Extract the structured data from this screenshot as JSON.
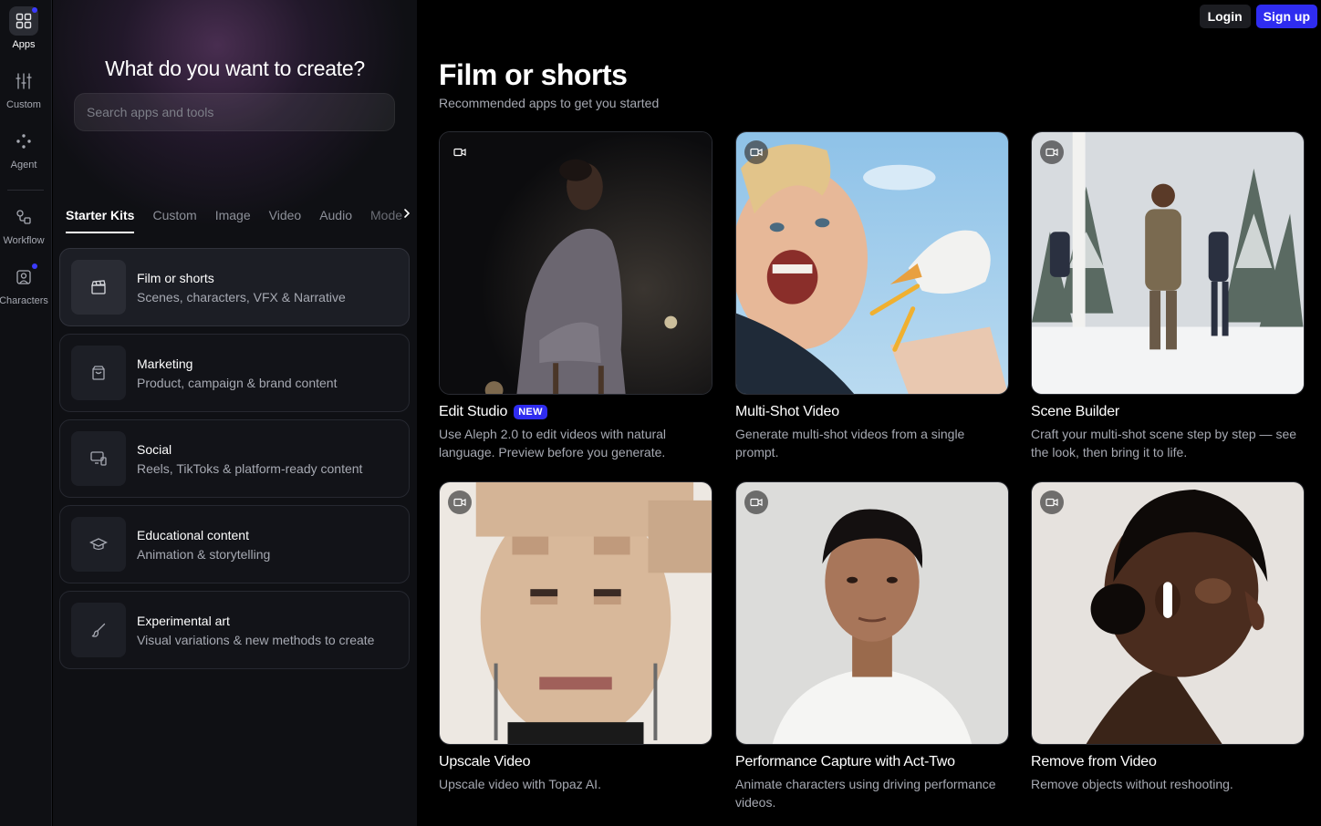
{
  "rail": {
    "items": [
      {
        "label": "Apps",
        "icon": "grid-icon",
        "active": true,
        "dot": true
      },
      {
        "label": "Custom",
        "icon": "sliders-icon",
        "active": false,
        "dot": false
      },
      {
        "label": "Agent",
        "icon": "sparkle-dots-icon",
        "active": false,
        "dot": false
      },
      {
        "label": "Workflow",
        "icon": "workflow-icon",
        "active": false,
        "dot": false
      },
      {
        "label": "Characters",
        "icon": "character-icon",
        "active": false,
        "dot": true
      }
    ]
  },
  "panel": {
    "title": "What do you want to create?",
    "search_placeholder": "Search apps and tools",
    "tabs": [
      "Starter Kits",
      "Custom",
      "Image",
      "Video",
      "Audio",
      "Mode"
    ],
    "kits": [
      {
        "title": "Film or shorts",
        "subtitle": "Scenes, characters, VFX & Narrative",
        "icon": "clapperboard-icon"
      },
      {
        "title": "Marketing",
        "subtitle": "Product, campaign & brand content",
        "icon": "shopping-bag-icon"
      },
      {
        "title": "Social",
        "subtitle": "Reels, TikToks & platform-ready content",
        "icon": "devices-icon"
      },
      {
        "title": "Educational content",
        "subtitle": "Animation & storytelling",
        "icon": "graduation-cap-icon"
      },
      {
        "title": "Experimental art",
        "subtitle": "Visual variations & new methods to create",
        "icon": "brush-icon"
      }
    ]
  },
  "header": {
    "login": "Login",
    "signup": "Sign up"
  },
  "main": {
    "title": "Film or shorts",
    "subtitle": "Recommended apps to get you started",
    "cards": [
      {
        "title": "Edit Studio",
        "badge": "NEW",
        "desc": "Use Aleph 2.0 to edit videos with natural language. Preview before you generate."
      },
      {
        "title": "Multi-Shot Video",
        "badge": "",
        "desc": "Generate multi-shot videos from a single prompt."
      },
      {
        "title": "Scene Builder",
        "badge": "",
        "desc": "Craft your multi-shot scene step by step — see the look, then bring it to life."
      },
      {
        "title": "Upscale Video",
        "badge": "",
        "desc": "Upscale video with Topaz AI."
      },
      {
        "title": "Performance Capture with Act-Two",
        "badge": "",
        "desc": "Animate characters using driving performance videos."
      },
      {
        "title": "Remove from Video",
        "badge": "",
        "desc": "Remove objects without reshooting."
      }
    ]
  },
  "colors": {
    "accent": "#2f2cf0",
    "panel_bg": "#0f1014",
    "main_bg": "#000000",
    "muted_text": "#a6a9b2"
  }
}
